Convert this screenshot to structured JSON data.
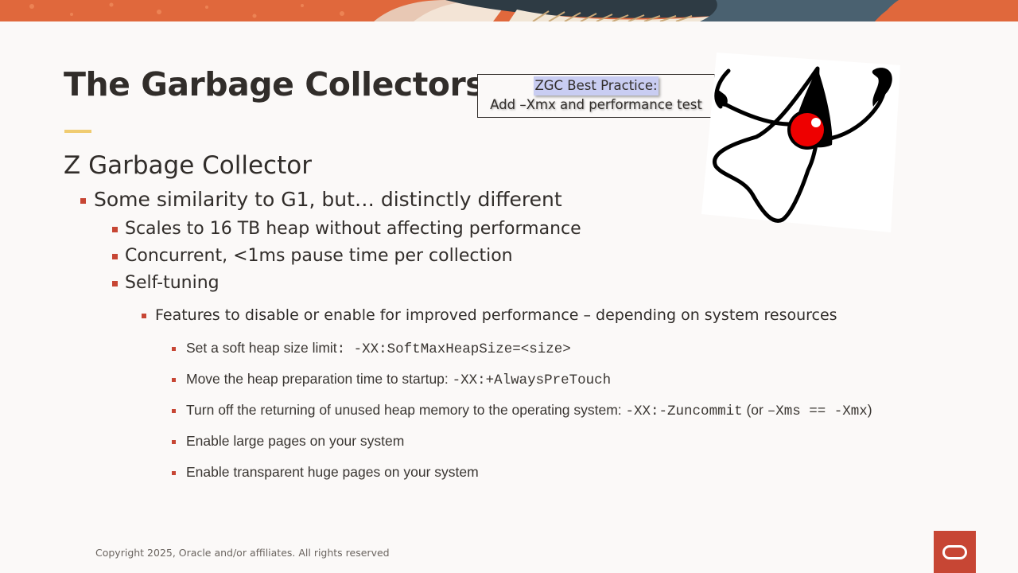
{
  "slide": {
    "title": "The Garbage Collectors",
    "callout": {
      "line1": "ZGC Best Practice:",
      "line2": "Add –Xmx and performance test"
    },
    "subtitle": "Z Garbage Collector",
    "level1": "Some similarity to G1, but… distinctly different",
    "level2": [
      "Scales to 16 TB heap without affecting performance",
      "Concurrent, <1ms pause time per collection",
      "Self-tuning"
    ],
    "level3": "Features to disable or enable for improved performance – depending on system resources",
    "level4": [
      {
        "text": "Set a soft heap size limit",
        "code": ": -XX:SoftMaxHeapSize=<size>"
      },
      {
        "text": "Move the heap preparation time to startup: ",
        "code": "-XX:+AlwaysPreTouch"
      },
      {
        "text": "Turn off the returning of unused heap memory to the operating system: ",
        "code": "-XX:-Zuncommit",
        "paren_open": " (or ",
        "paren_code": "–Xms == -Xmx",
        "paren_close": ")"
      },
      {
        "text": "Enable large pages on your system"
      },
      {
        "text": "Enable transparent huge pages on your system"
      }
    ],
    "copyright": "Copyright 2025, Oracle and/or affiliates. All rights reserved"
  },
  "images": {
    "mascot": "duke-mascot-drawing",
    "logo": "oracle-logo-icon"
  },
  "colors": {
    "background": "#fbf9f8",
    "text": "#312d2a",
    "accent_red": "#c74634",
    "title_rule": "#f0cc71",
    "banner_orange": "#e0683c",
    "callout_highlight": "#c9cdf2"
  }
}
